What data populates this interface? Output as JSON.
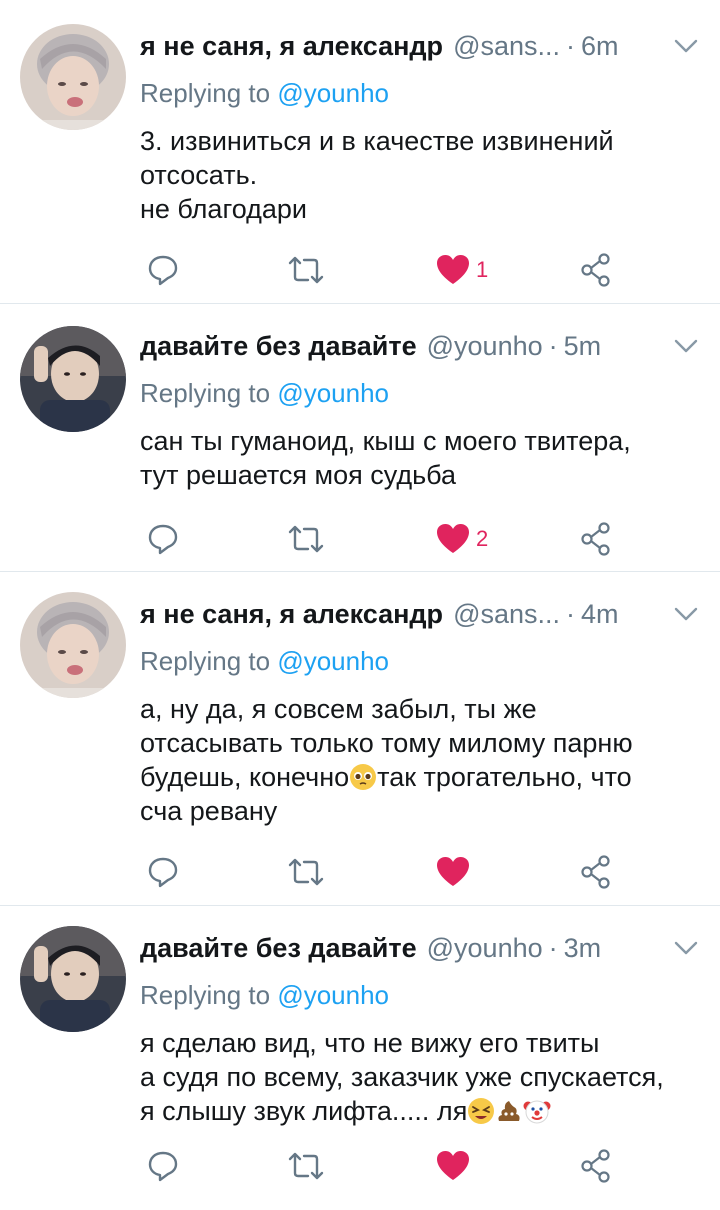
{
  "colors": {
    "link": "#1da1f2",
    "muted": "#657786",
    "like": "#e0245e",
    "divider": "#e1e8ed"
  },
  "tweets": [
    {
      "name": "я не саня, я александр",
      "handle": "@sans...",
      "time": "6m",
      "replying_prefix": "Replying to ",
      "replying_to": "@younho",
      "lines": [
        "3. извиниться и в качестве извинений",
        "отсосать.",
        "не благодари"
      ],
      "liked": true,
      "like_count": "1",
      "avatar": "avatar-light-hair"
    },
    {
      "name": "давайте без давайте",
      "handle": "@younho",
      "time": "5m",
      "replying_prefix": "Replying to ",
      "replying_to": "@younho",
      "lines": [
        "сан ты гуманоид, кыш с моего твитера,",
        "тут решается моя судьба"
      ],
      "liked": true,
      "like_count": "2",
      "avatar": "avatar-dark-hair"
    },
    {
      "name": "я не саня, я александр",
      "handle": "@sans...",
      "time": "4m",
      "replying_prefix": "Replying to ",
      "replying_to": "@younho",
      "lines": [
        "а, ну да, я совсем забыл, ты же",
        "отсасывать только тому милому парню",
        "будешь, конечно",
        "так трогательно, что",
        "сча ревану"
      ],
      "liked": true,
      "like_count": "",
      "avatar": "avatar-light-hair"
    },
    {
      "name": "давайте без давайте",
      "handle": "@younho",
      "time": "3m",
      "replying_prefix": "Replying to ",
      "replying_to": "@younho",
      "lines": [
        "я сделаю вид, что не вижу его твиты",
        "а судя по всему, заказчик уже спускается,",
        "я слышу звук лифта..... ля"
      ],
      "liked": true,
      "like_count": "",
      "avatar": "avatar-dark-hair"
    }
  ],
  "icons": {
    "reply": "reply-icon",
    "retweet": "retweet-icon",
    "like": "heart-icon",
    "share": "share-icon",
    "menu": "chevron-down-icon",
    "emoji_pleading": "pleading-face-emoji",
    "emoji_tired": "tired-face-emoji",
    "emoji_poop": "poop-emoji",
    "emoji_clown": "clown-face-emoji"
  }
}
